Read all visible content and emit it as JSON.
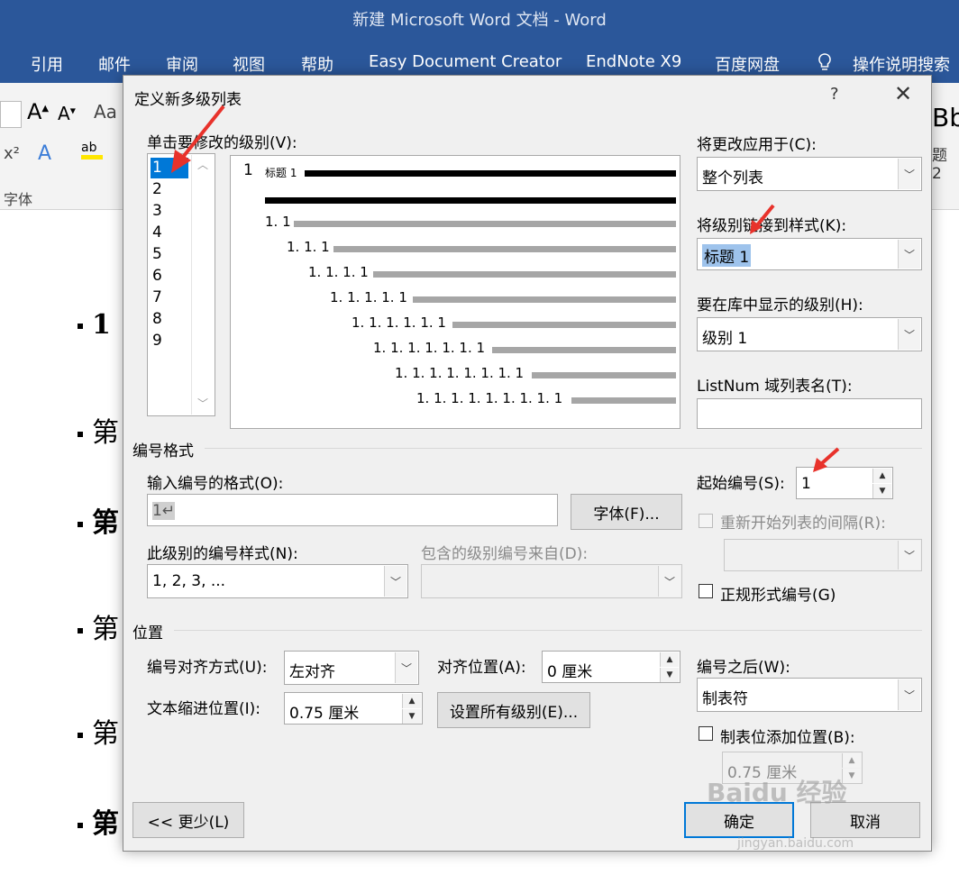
{
  "window": {
    "title": "新建 Microsoft Word 文档  -  Word"
  },
  "menu": {
    "items": [
      "引用",
      "邮件",
      "审阅",
      "视图",
      "帮助",
      "Easy Document Creator",
      "EndNote X9",
      "百度网盘"
    ],
    "search_label": "操作说明搜索"
  },
  "ribbon": {
    "font_group_label": "字体",
    "style_preview": "Bb",
    "style_label": "题 2"
  },
  "document": {
    "lines": [
      "1",
      "第",
      "第",
      "第",
      "第",
      "第"
    ]
  },
  "dialog": {
    "title": "定义新多级列表",
    "help": "?",
    "levels_label": "单击要修改的级别(V):",
    "levels": [
      "1",
      "2",
      "3",
      "4",
      "5",
      "6",
      "7",
      "8",
      "9"
    ],
    "selected_level": "1",
    "preview": {
      "l1_number": "1",
      "l1_text": "标题 1",
      "rows": [
        "1. 1",
        "1. 1. 1",
        "1. 1. 1. 1",
        "1. 1. 1. 1. 1",
        "1. 1. 1. 1. 1. 1",
        "1. 1. 1. 1. 1. 1. 1",
        "1. 1. 1. 1. 1. 1. 1. 1",
        "1. 1. 1. 1. 1. 1. 1. 1. 1"
      ]
    },
    "apply_to": {
      "label": "将更改应用于(C):",
      "value": "整个列表"
    },
    "link_style": {
      "label": "将级别链接到样式(K):",
      "value": "标题 1"
    },
    "gallery_level": {
      "label": "要在库中显示的级别(H):",
      "value": "级别 1"
    },
    "listnum": {
      "label": "ListNum 域列表名(T):",
      "value": ""
    },
    "number_format_group": "编号格式",
    "enter_format": {
      "label": "输入编号的格式(O):",
      "value": "1↵"
    },
    "font_button": "字体(F)...",
    "number_style": {
      "label": "此级别的编号样式(N):",
      "value": "1, 2, 3, ..."
    },
    "include_level": {
      "label": "包含的级别编号来自(D):",
      "value": ""
    },
    "start_at": {
      "label": "起始编号(S):",
      "value": "1"
    },
    "restart_after": {
      "label": "重新开始列表的间隔(R):",
      "value": "",
      "checked": false,
      "enabled": false
    },
    "legal_numbering": {
      "label": "正规形式编号(G)",
      "checked": false
    },
    "position_group": "位置",
    "alignment": {
      "label": "编号对齐方式(U):",
      "value": "左对齐"
    },
    "aligned_at": {
      "label": "对齐位置(A):",
      "value": "0 厘米"
    },
    "text_indent": {
      "label": "文本缩进位置(I):",
      "value": "0.75 厘米"
    },
    "set_all_button": "设置所有级别(E)...",
    "follow_with": {
      "label": "编号之后(W):",
      "value": "制表符"
    },
    "add_tab_stop": {
      "label": "制表位添加位置(B):",
      "checked": false,
      "value": "0.75 厘米"
    },
    "less_button": "<< 更少(L)",
    "ok_button": "确定",
    "cancel_button": "取消"
  },
  "watermark": {
    "text": "Baidu 经验",
    "url": "jingyan.baidu.com"
  },
  "colors": {
    "titlebar": "#2b579a",
    "selection": "#0078d7",
    "arrow": "#e8322b"
  }
}
